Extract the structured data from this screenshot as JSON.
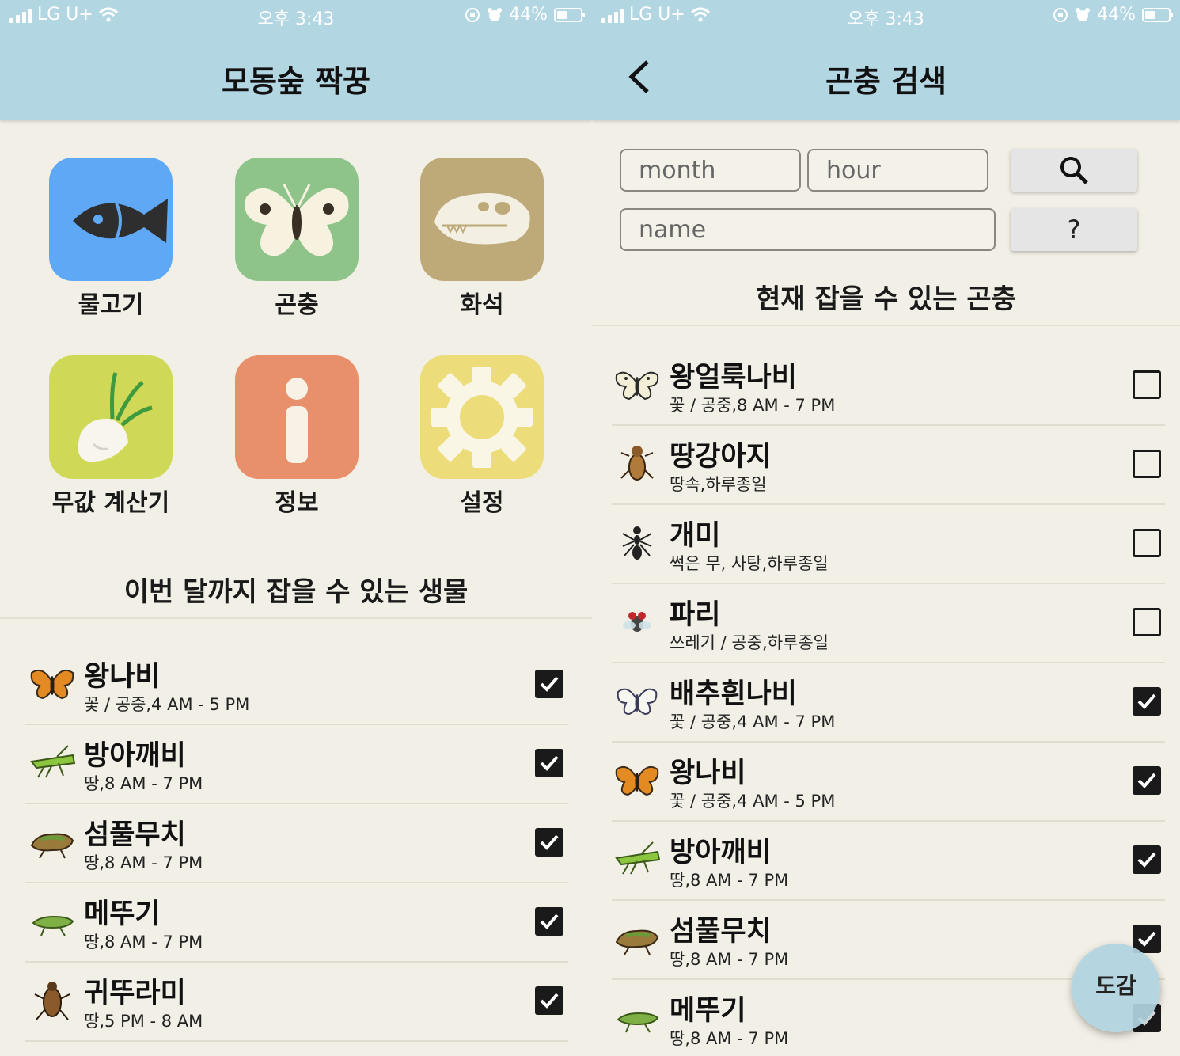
{
  "status_bar": {
    "carrier": "LG U+",
    "time": "오후 3:43",
    "battery": "44%"
  },
  "left_screen": {
    "title": "모동숲 짝꿍",
    "tiles": [
      {
        "label": "물고기",
        "icon": "fish-icon",
        "color": "#5fa8f5"
      },
      {
        "label": "곤충",
        "icon": "butterfly-icon",
        "color": "#8ec48a"
      },
      {
        "label": "화석",
        "icon": "fossil-skull-icon",
        "color": "#bea979"
      },
      {
        "label": "무값 계산기",
        "icon": "turnip-icon",
        "color": "#cfd957"
      },
      {
        "label": "정보",
        "icon": "info-icon",
        "color": "#e8906b"
      },
      {
        "label": "설정",
        "icon": "gear-icon",
        "color": "#eddc7a"
      }
    ],
    "section_title": "이번 달까지 잡을 수 있는 생물",
    "items": [
      {
        "name": "왕나비",
        "detail": "꽃 / 공중,4 AM - 5 PM",
        "icon": "monarch-butterfly-icon",
        "checked": true
      },
      {
        "name": "방아깨비",
        "detail": "땅,8 AM - 7 PM",
        "icon": "grasshopper-icon",
        "checked": true
      },
      {
        "name": "섬풀무치",
        "detail": "땅,8 AM - 7 PM",
        "icon": "locust-icon",
        "checked": true
      },
      {
        "name": "메뚜기",
        "detail": "땅,8 AM - 7 PM",
        "icon": "rice-grasshopper-icon",
        "checked": true
      },
      {
        "name": "귀뚜라미",
        "detail": "땅,5 PM - 8 AM",
        "icon": "cricket-icon",
        "checked": true
      }
    ]
  },
  "right_screen": {
    "title": "곤충 검색",
    "search": {
      "month_placeholder": "month",
      "hour_placeholder": "hour",
      "name_placeholder": "name",
      "help_label": "?"
    },
    "section_title": "현재 잡을 수 있는 곤충",
    "items": [
      {
        "name": "왕얼룩나비",
        "detail": "꽃 / 공중,8 AM - 7 PM",
        "icon": "paper-kite-butterfly-icon",
        "checked": false
      },
      {
        "name": "땅강아지",
        "detail": "땅속,하루종일",
        "icon": "mole-cricket-icon",
        "checked": false
      },
      {
        "name": "개미",
        "detail": "썩은 무, 사탕,하루종일",
        "icon": "ant-icon",
        "checked": false
      },
      {
        "name": "파리",
        "detail": "쓰레기 / 공중,하루종일",
        "icon": "fly-icon",
        "checked": false
      },
      {
        "name": "배추흰나비",
        "detail": "꽃 / 공중,4 AM - 7 PM",
        "icon": "cabbage-butterfly-icon",
        "checked": true
      },
      {
        "name": "왕나비",
        "detail": "꽃 / 공중,4 AM - 5 PM",
        "icon": "monarch-butterfly-icon",
        "checked": true
      },
      {
        "name": "방아깨비",
        "detail": "땅,8 AM - 7 PM",
        "icon": "grasshopper-icon",
        "checked": true
      },
      {
        "name": "섬풀무치",
        "detail": "땅,8 AM - 7 PM",
        "icon": "locust-icon",
        "checked": true
      },
      {
        "name": "메뚜기",
        "detail": "땅,8 AM - 7 PM",
        "icon": "rice-grasshopper-icon",
        "checked": true
      }
    ],
    "fab_label": "도감"
  },
  "colors": {
    "header": "#b3d6e3",
    "background": "#f2f0e6",
    "checkbox": "#1a1a1a"
  }
}
